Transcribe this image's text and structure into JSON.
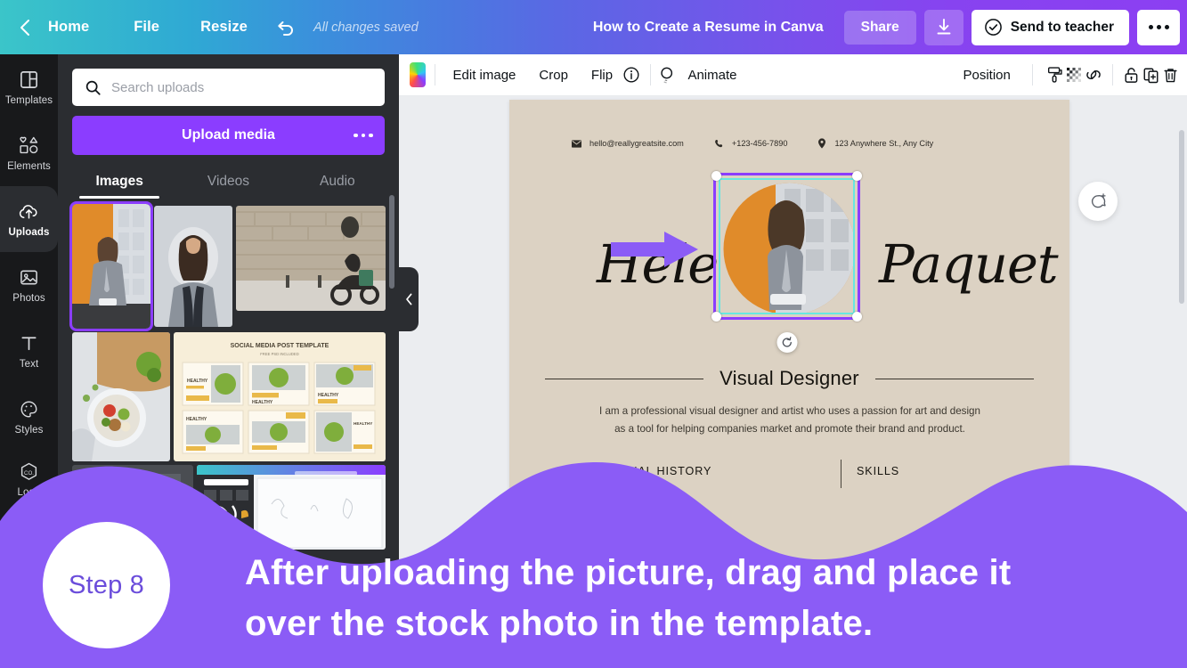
{
  "header": {
    "back_icon": "chevron-left-icon",
    "home_label": "Home",
    "file_label": "File",
    "resize_label": "Resize",
    "undo_icon": "undo-icon",
    "save_status": "All changes saved",
    "doc_title": "How to Create a Resume in Canva",
    "share_label": "Share",
    "download_icon": "download-icon",
    "send_label": "Send to teacher",
    "send_icon": "check-circle-icon",
    "more_icon": "ellipsis-icon",
    "gradient_start": "#3bc5c9",
    "gradient_end": "#8c3ff2"
  },
  "sidebar": {
    "items": [
      {
        "label": "Templates",
        "icon": "templates-icon",
        "active": false
      },
      {
        "label": "Elements",
        "icon": "elements-icon",
        "active": false
      },
      {
        "label": "Uploads",
        "icon": "cloud-upload-icon",
        "active": true
      },
      {
        "label": "Photos",
        "icon": "photos-icon",
        "active": false
      },
      {
        "label": "Text",
        "icon": "text-icon",
        "active": false
      },
      {
        "label": "Styles",
        "icon": "styles-palette-icon",
        "active": false
      },
      {
        "label": "Logo",
        "icon": "logo-hexagon-icon",
        "active": false
      }
    ]
  },
  "uploads_panel": {
    "search_placeholder": "Search uploads",
    "search_value": "",
    "search_icon": "search-icon",
    "upload_button_label": "Upload media",
    "upload_more_icon": "ellipsis-icon",
    "accent_color": "#8b3dff",
    "tabs": [
      {
        "label": "Images",
        "active": true
      },
      {
        "label": "Videos",
        "active": false
      },
      {
        "label": "Audio",
        "active": false
      }
    ],
    "collapse_icon": "chevron-left-icon"
  },
  "editor_toolbar": {
    "thumbnail_icon": "image-thumbnail",
    "edit_image_label": "Edit image",
    "crop_label": "Crop",
    "flip_label": "Flip",
    "info_icon": "info-icon",
    "animate_label": "Animate",
    "animate_icon": "animate-icon",
    "position_label": "Position",
    "tools": [
      {
        "icon": "paint-roller-icon"
      },
      {
        "icon": "transparency-icon"
      },
      {
        "icon": "link-icon"
      },
      {
        "icon": "lock-icon"
      },
      {
        "icon": "duplicate-icon"
      },
      {
        "icon": "trash-icon"
      }
    ]
  },
  "canvas": {
    "page_bg": "#dcd2c3",
    "workspace_bg": "#ebedf0",
    "zoom_level": "75%",
    "comment_icon": "add-comment-icon",
    "selection_color": "#8b3dff",
    "crop_border_color": "#67e8e0",
    "rotate_icon": "rotate-icon"
  },
  "resume": {
    "email": "hello@reallygreatsite.com",
    "email_icon": "mail-icon",
    "phone": "+123-456-7890",
    "phone_icon": "phone-icon",
    "address": "123 Anywhere St., Any City",
    "address_icon": "location-pin-icon",
    "first_name": "Helene",
    "last_name": "Paquet",
    "role": "Visual Designer",
    "bio_line1": "I am a professional visual designer and artist who uses a passion for art and design",
    "bio_line2": "as a tool for helping companies market and promote their brand and product.",
    "section_left": "EDUCATIONAL HISTORY",
    "section_right": "SKILLS"
  },
  "overlay": {
    "step_label": "Step 8",
    "caption_line1": "After uploading the picture, drag and place it",
    "caption_line2": "over the stock photo in the template.",
    "wave_color": "#8b5cf6",
    "badge_text_color": "#6b4ddb",
    "arrow_icon": "arrow-right-cursor",
    "arrow_up_icon": "arrow-up-icon"
  }
}
